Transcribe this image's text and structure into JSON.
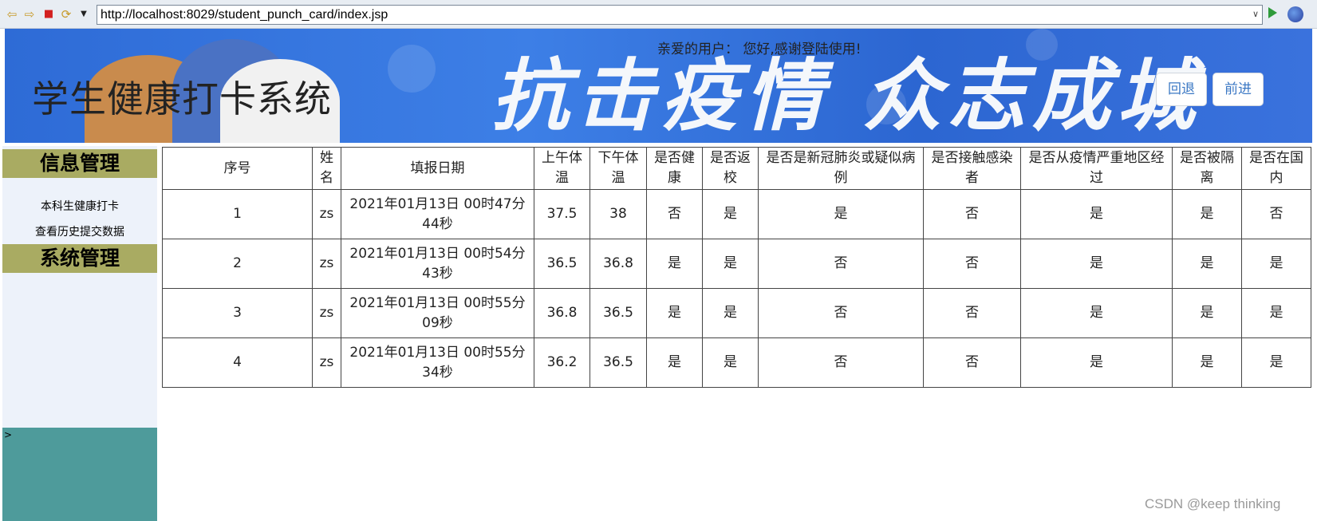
{
  "browser": {
    "url": "http://localhost:8029/student_punch_card/index.jsp"
  },
  "header": {
    "site_title": "学生健康打卡系统",
    "welcome": "亲爱的用户：  您好,感谢登陆使用!",
    "slogan": "抗击疫情 众志成城",
    "back_label": "回退",
    "forward_label": "前进"
  },
  "sidebar": {
    "section_info": "信息管理",
    "link_punch": "本科生健康打卡",
    "link_history": "查看历史提交数据",
    "section_system": "系统管理",
    "bottom_mark": ">"
  },
  "table": {
    "headers": [
      "序号",
      "姓名",
      "填报日期",
      "上午体温",
      "下午体温",
      "是否健康",
      "是否返校",
      "是否是新冠肺炎或疑似病例",
      "是否接触感染者",
      "是否从疫情严重地区经过",
      "是否被隔离",
      "是否在国内"
    ],
    "rows": [
      [
        "1",
        "zs",
        "2021年01月13日 00时47分44秒",
        "37.5",
        "38",
        "否",
        "是",
        "是",
        "否",
        "是",
        "是",
        "否"
      ],
      [
        "2",
        "zs",
        "2021年01月13日 00时54分43秒",
        "36.5",
        "36.8",
        "是",
        "是",
        "否",
        "否",
        "是",
        "是",
        "是"
      ],
      [
        "3",
        "zs",
        "2021年01月13日 00时55分09秒",
        "36.8",
        "36.5",
        "是",
        "是",
        "否",
        "否",
        "是",
        "是",
        "是"
      ],
      [
        "4",
        "zs",
        "2021年01月13日 00时55分34秒",
        "36.2",
        "36.5",
        "是",
        "是",
        "否",
        "否",
        "是",
        "是",
        "是"
      ]
    ]
  },
  "watermark": "CSDN @keep   thinking"
}
